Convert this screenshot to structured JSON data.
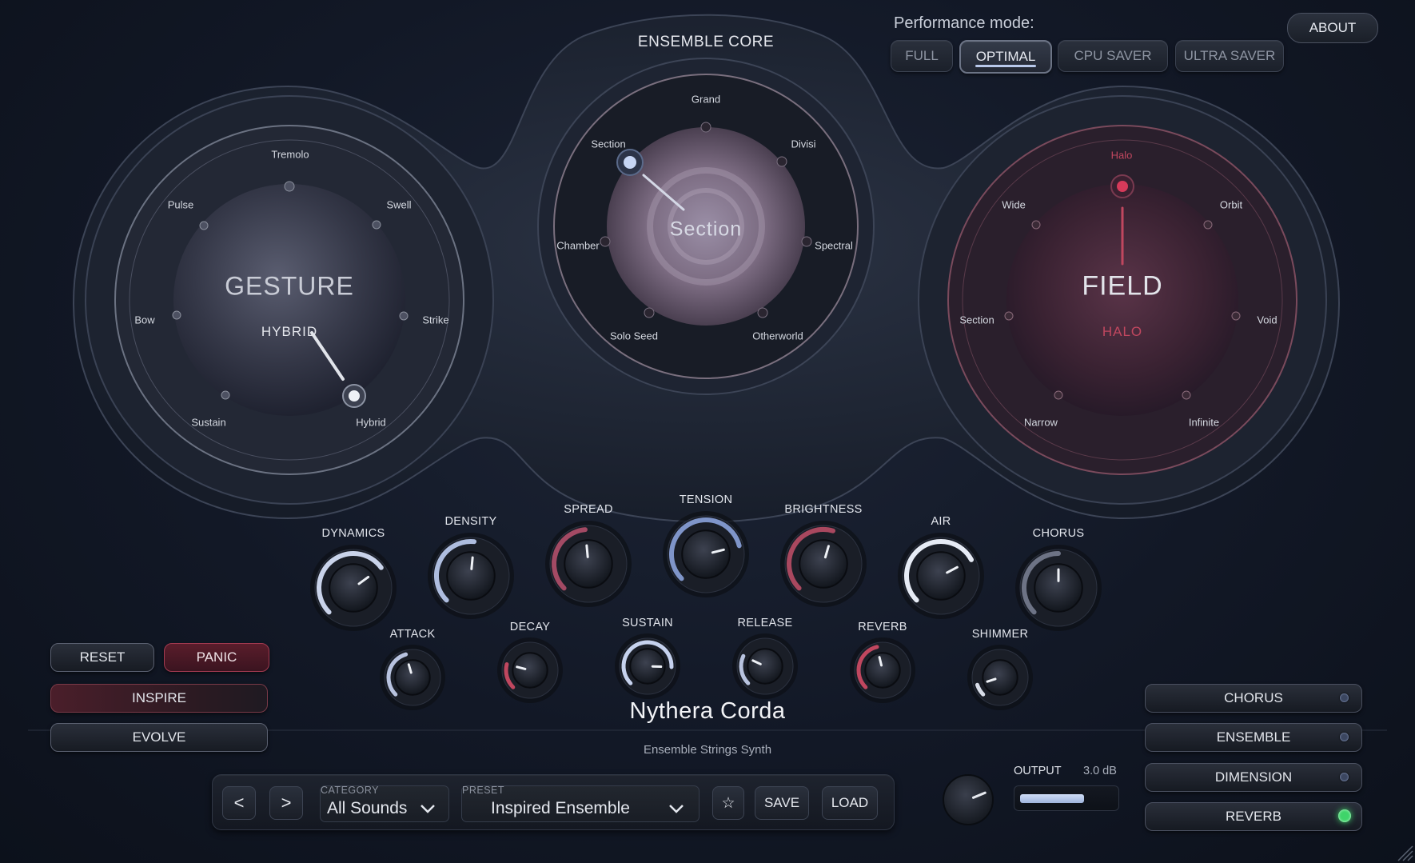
{
  "header": {
    "perf_label": "Performance mode:",
    "perf_modes": [
      "FULL",
      "OPTIMAL",
      "CPU SAVER",
      "ULTRA SAVER"
    ],
    "perf_active": "OPTIMAL",
    "about": "ABOUT",
    "core_title": "ENSEMBLE CORE"
  },
  "gesture": {
    "title": "GESTURE",
    "value": "HYBRID",
    "options": [
      "Tremolo",
      "Swell",
      "Strike",
      "Hybrid",
      "Sustain",
      "Bow",
      "Pulse"
    ]
  },
  "core": {
    "value": "Section",
    "options": [
      "Grand",
      "Divisi",
      "Spectral",
      "Otherworld",
      "Solo Seed",
      "Chamber",
      "Section"
    ]
  },
  "field": {
    "title": "FIELD",
    "value": "HALO",
    "options": [
      "Halo",
      "Orbit",
      "Void",
      "Infinite",
      "Narrow",
      "Section",
      "Wide"
    ]
  },
  "knobs_top": [
    {
      "label": "DYNAMICS",
      "value": 0.7
    },
    {
      "label": "DENSITY",
      "value": 0.52
    },
    {
      "label": "SPREAD",
      "value": 0.48
    },
    {
      "label": "TENSION",
      "value": 0.78
    },
    {
      "label": "BRIGHTNESS",
      "value": 0.56
    },
    {
      "label": "AIR",
      "value": 0.73
    },
    {
      "label": "CHORUS",
      "value": 0.5
    }
  ],
  "knobs_bottom": [
    {
      "label": "ATTACK",
      "value": 0.44
    },
    {
      "label": "DECAY",
      "value": 0.22
    },
    {
      "label": "SUSTAIN",
      "value": 0.84
    },
    {
      "label": "RELEASE",
      "value": 0.26
    },
    {
      "label": "REVERB",
      "value": 0.45
    },
    {
      "label": "SHIMMER",
      "value": 0.1
    }
  ],
  "left_controls": {
    "reset": "RESET",
    "panic": "PANIC",
    "inspire": "INSPIRE",
    "evolve": "EVOLVE"
  },
  "synth": {
    "name": "Nythera Corda",
    "subtitle": "Ensemble Strings Synth"
  },
  "browser": {
    "prev": "<",
    "next": ">",
    "category_caption": "CATEGORY",
    "category_value": "All Sounds",
    "preset_caption": "PRESET",
    "preset_value": "Inspired Ensemble",
    "favorite": "☆",
    "save": "SAVE",
    "load": "LOAD"
  },
  "output": {
    "label": "OUTPUT",
    "value": "3.0 dB",
    "level": 0.72,
    "knob_value": 0.75
  },
  "effects": [
    {
      "label": "CHORUS",
      "on": false
    },
    {
      "label": "ENSEMBLE",
      "on": false
    },
    {
      "label": "DIMENSION",
      "on": false
    },
    {
      "label": "REVERB",
      "on": true
    }
  ],
  "colors": {
    "accent_blue": "#a9bde6",
    "accent_red": "#c0475f",
    "led_on": "#3fd46a",
    "background": "#121826"
  }
}
